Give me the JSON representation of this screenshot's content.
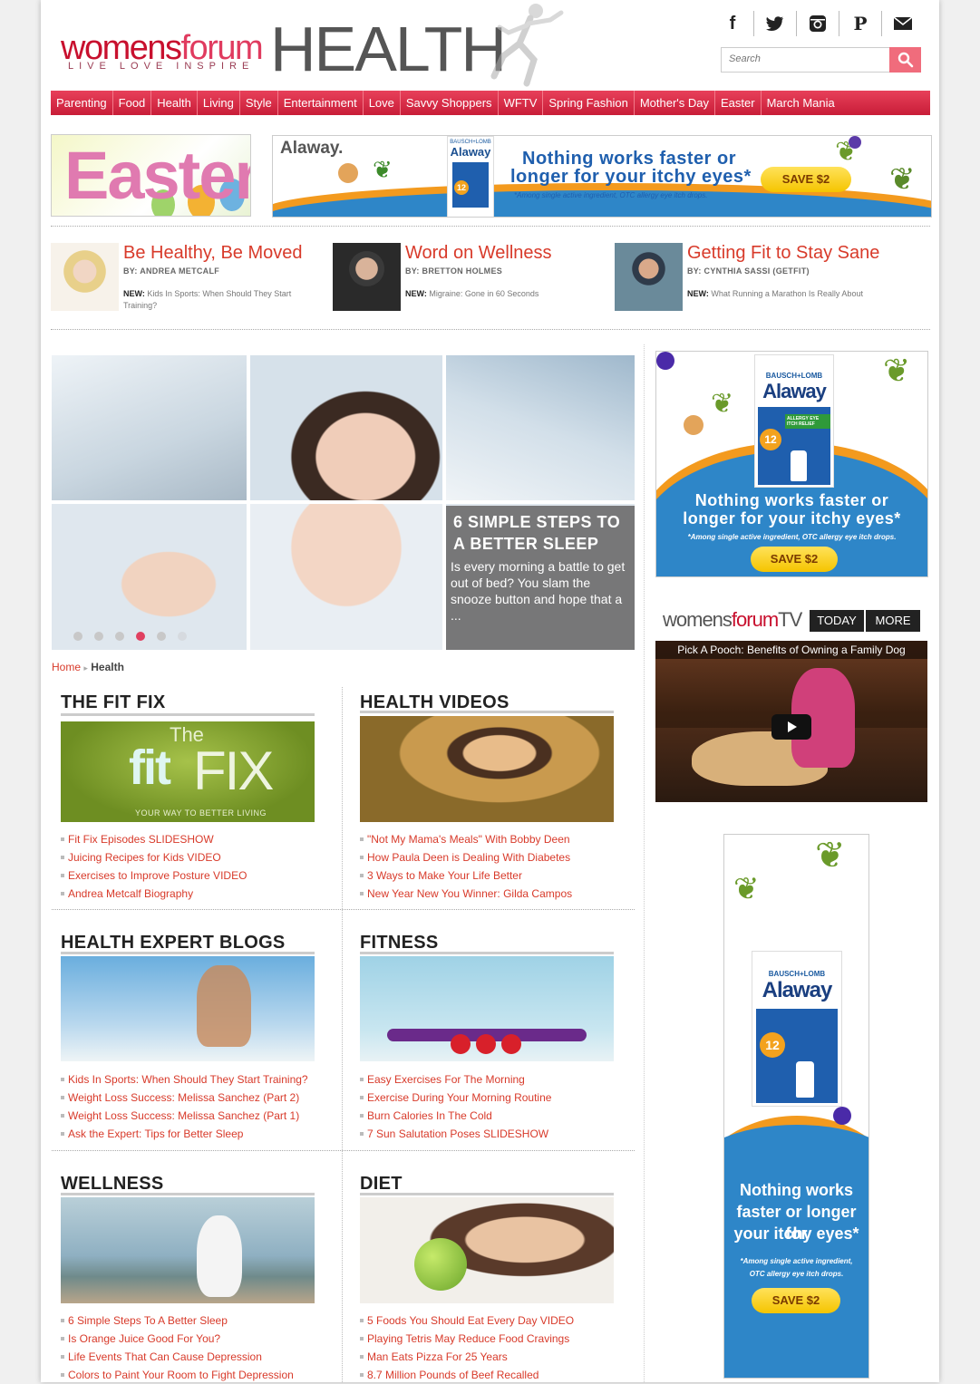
{
  "header": {
    "logo_main": "womens",
    "logo_accent": "forum",
    "logo_tagline": "LIVE  LOVE  INSPIRE",
    "section_title": "HEALTH",
    "social_icons": [
      "facebook-icon",
      "twitter-icon",
      "instagram-icon",
      "pinterest-icon",
      "email-icon"
    ],
    "search_placeholder": "Search"
  },
  "nav": [
    "Parenting",
    "Food",
    "Health",
    "Living",
    "Style",
    "Entertainment",
    "Love",
    "Savvy Shoppers",
    "WFTV",
    "Spring Fashion",
    "Mother's Day",
    "Easter",
    "March Mania"
  ],
  "banners": {
    "easter_text": "Easter",
    "ad_brand": "Alaway.",
    "ad_maker": "BAUSCH+LOMB",
    "ad_product": "Alaway",
    "ad_headline_1": "Nothing works faster or",
    "ad_headline_2": "longer for your itchy eyes*",
    "ad_note": "*Among single active ingredient, OTC allergy eye itch drops.",
    "ad_cta": "SAVE $2",
    "ad_badge": "12"
  },
  "bloggers": [
    {
      "title": "Be Healthy, Be Moved",
      "by": "BY: ANDREA METCALF",
      "new_label": "NEW:",
      "new_text": "Kids In Sports: When Should They Start Training?"
    },
    {
      "title": "Word on Wellness",
      "by": "BY: BRETTON HOLMES",
      "new_label": "NEW:",
      "new_text": "Migraine: Gone in 60 Seconds"
    },
    {
      "title": "Getting Fit to Stay Sane",
      "by": "BY: CYNTHIA SASSI (GETFIT)",
      "new_label": "NEW:",
      "new_text": "What Running a Marathon Is Really About"
    }
  ],
  "slideshow": {
    "title": "6 SIMPLE STEPS TO A BETTER SLEEP",
    "text": "Is every morning a battle to get out of bed? You slam the snooze button and hope that a ...",
    "dot_count": 6,
    "active_dot": 4
  },
  "breadcrumb": {
    "home": "Home",
    "current": "Health"
  },
  "sections": [
    {
      "title": "THE FIT FIX",
      "image_text_1": "The",
      "image_text_2": "fit",
      "image_text_3": "FIX",
      "image_text_4": "YOUR WAY TO BETTER LIVING",
      "links": [
        "Fit Fix Episodes SLIDESHOW",
        "Juicing Recipes for Kids VIDEO",
        "Exercises to Improve Posture VIDEO",
        "Andrea Metcalf Biography"
      ]
    },
    {
      "title": "HEALTH VIDEOS",
      "links": [
        "\"Not My Mama's Meals\" With Bobby Deen",
        "How Paula Deen is Dealing With Diabetes",
        "3 Ways to Make Your Life Better",
        "New Year New You Winner: Gilda Campos"
      ]
    },
    {
      "title": "HEALTH EXPERT BLOGS",
      "links": [
        "Kids In Sports: When Should They Start Training?",
        "Weight Loss Success: Melissa Sanchez (Part 2)",
        "Weight Loss Success: Melissa Sanchez (Part 1)",
        "Ask the Expert: Tips for Better Sleep"
      ]
    },
    {
      "title": "FITNESS",
      "links": [
        "Easy Exercises For The Morning",
        "Exercise During Your Morning Routine",
        "Burn Calories In The Cold",
        "7 Sun Salutation Poses SLIDESHOW"
      ]
    },
    {
      "title": "WELLNESS",
      "links": [
        "6 Simple Steps To A Better Sleep",
        "Is Orange Juice Good For You?",
        "Life Events That Can Cause Depression",
        "Colors to Paint Your Room to Fight Depression"
      ]
    },
    {
      "title": "DIET",
      "links": [
        "5 Foods You Should Eat Every Day VIDEO",
        "Playing Tetris May Reduce Food Cravings",
        "Man Eats Pizza For 25 Years",
        "8.7 Million Pounds of Beef Recalled"
      ]
    }
  ],
  "side_ad": {
    "maker": "BAUSCH+LOMB",
    "product": "Alaway",
    "badge": "12",
    "label": "ALLERGY EYE ITCH RELIEF",
    "headline_1": "Nothing works faster or",
    "headline_2": "longer for your itchy eyes*",
    "note": "*Among single active ingredient, OTC allergy eye itch drops.",
    "cta": "SAVE $2"
  },
  "tv": {
    "logo_main": "womens",
    "logo_accent": "forum",
    "logo_suffix": "TV",
    "tab_today": "TODAY",
    "tab_more": "MORE",
    "video_title": "Pick A Pooch: Benefits of Owning a Family Dog"
  },
  "tall_ad": {
    "maker": "BAUSCH+LOMB",
    "product": "Alaway",
    "badge": "12",
    "headline_1": "Nothing works",
    "headline_2": "faster or longer for",
    "headline_3": "your itchy eyes*",
    "note_1": "*Among single active ingredient,",
    "note_2": "OTC allergy eye itch drops.",
    "cta": "SAVE $2"
  }
}
